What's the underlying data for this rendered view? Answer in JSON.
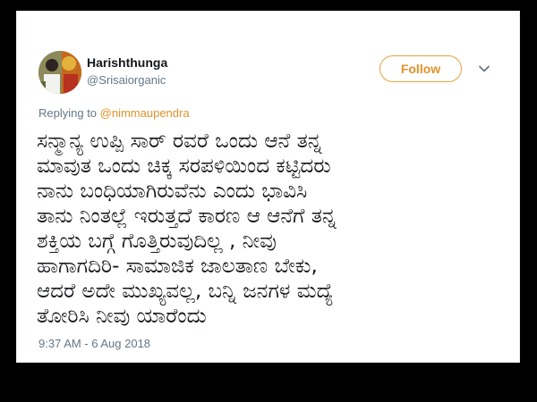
{
  "tweet": {
    "author_name": "Harishthunga",
    "author_handle": "@Srisaiorganic",
    "follow_label": "Follow",
    "more_icon": "chevron-down-icon",
    "reply_prefix": "Replying to ",
    "reply_mention": "@nimmaupendra",
    "text": "ಸನ್ಮಾನ್ಯ ಉಪ್ಪಿ ಸಾರ್ ರವರೆ ಒಂದು ಆನೆ ತನ್ನ\nಮಾವುತ ಒಂದು ಚಿಕ್ಕ ಸರಪಳಿಯಿಂದ ಕಟ್ಟಿದರು\nನಾನು ಬಂಧಿಯಾಗಿರುವೆನು ಎಂದು ಭಾವಿಸಿ\nತಾನು ನಿಂತಲ್ಲೆ ಇರುತ್ತದೆ ಕಾರಣ ಆ ಆನೆಗೆ ತನ್ನ\nಶಕ್ತಿಯ ಬಗ್ಗೆ ಗೊತ್ತಿರುವುದಿಲ್ಲ , ನೀವು\nಹಾಗಾಗದಿರಿ-  ಸಾಮಾಜಿಕ ಜಾಲತಾಣ ಬೇಕು,\nಆದರೆ ಅದೇ ಮುಖ್ಯವಲ್ಲ, ಬನ್ನಿ ಜನಗಳ ಮದ್ಯೆ\nತೋರಿಸಿ ನೀವು ಯಾರೆಂದು",
    "timestamp": "9:37 AM - 6 Aug 2018"
  },
  "colors": {
    "accent": "#e2912a",
    "text_primary": "#14171a",
    "text_secondary": "#657786",
    "background": "#000000",
    "card": "#ffffff"
  }
}
